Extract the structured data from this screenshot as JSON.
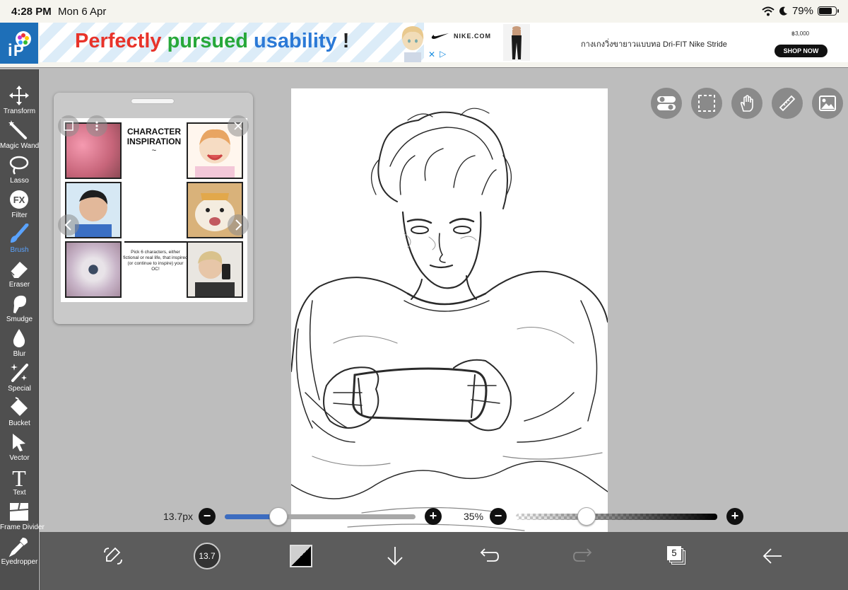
{
  "status": {
    "time": "4:28 PM",
    "date": "Mon 6 Apr",
    "battery": "79%",
    "battery_level": 0.79
  },
  "ad": {
    "slogan": {
      "w1": "Perfectly",
      "w2": "pursued",
      "w3": "usability",
      "w4": "!"
    },
    "nike_brand": "NIKE.COM",
    "product_title": "กางเกงวิ่งขายาวแบบทอ Dri-FIT Nike Stride",
    "price": "฿3,000",
    "shop_now": "SHOP NOW",
    "close": "✕",
    "adchoice": "▷"
  },
  "tools": [
    {
      "label": "Transform",
      "icon": "transform-icon"
    },
    {
      "label": "Magic Wand",
      "icon": "magic-wand-icon"
    },
    {
      "label": "Lasso",
      "icon": "lasso-icon"
    },
    {
      "label": "Filter",
      "icon": "filter-icon"
    },
    {
      "label": "Brush",
      "icon": "brush-icon",
      "active": true
    },
    {
      "label": "Eraser",
      "icon": "eraser-icon"
    },
    {
      "label": "Smudge",
      "icon": "smudge-icon"
    },
    {
      "label": "Blur",
      "icon": "blur-icon"
    },
    {
      "label": "Special",
      "icon": "special-icon"
    },
    {
      "label": "Bucket",
      "icon": "bucket-icon"
    },
    {
      "label": "Vector",
      "icon": "vector-icon"
    },
    {
      "label": "Text",
      "icon": "text-icon"
    },
    {
      "label": "Frame Divider",
      "icon": "frame-divider-icon"
    },
    {
      "label": "Eyedropper",
      "icon": "eyedropper-icon"
    }
  ],
  "filter_icon_text": "FX",
  "text_icon_text": "T",
  "reference": {
    "title": "CHARACTER INSPIRATION",
    "tilde": "~",
    "caption": "Pick 6 characters, either fictional or real life, that inspired (or continue to inspire) your OC!"
  },
  "brush_slider": {
    "value_label": "13.7px",
    "level": 0.28
  },
  "opacity_slider": {
    "value_label": "35%",
    "level": 0.35
  },
  "bottom": {
    "brush_size": "13.7",
    "layers_count": "5"
  },
  "colors": {
    "accent": "#5aa3ff",
    "toolbar": "#4f4f4f",
    "bottombar": "#5c5c5c",
    "workspace": "#bdbdbd"
  }
}
